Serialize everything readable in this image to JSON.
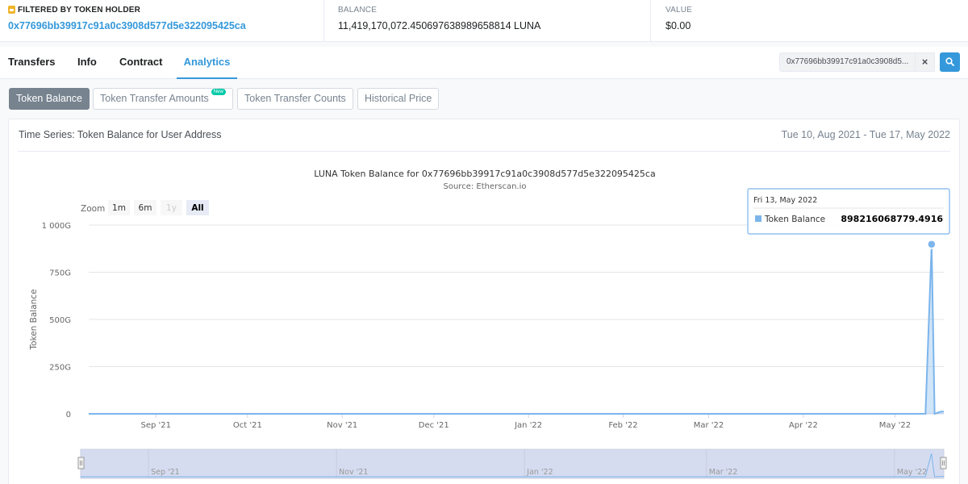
{
  "summary": {
    "filtered_label": "FILTERED BY TOKEN HOLDER",
    "holder_address": "0x77696bb39917c91a0c3908d577d5e322095425ca",
    "balance_label": "BALANCE",
    "balance_value": "11,419,170,072.450697638989658814 LUNA",
    "value_label": "VALUE",
    "value_amount": "$0.00"
  },
  "tabs": [
    {
      "label": "Transfers"
    },
    {
      "label": "Info"
    },
    {
      "label": "Contract"
    },
    {
      "label": "Analytics"
    }
  ],
  "active_tab": "Analytics",
  "search": {
    "value": "0x77696bb39917c91a0c3908d5...",
    "clear_icon": "×"
  },
  "chips": [
    {
      "label": "Token Balance"
    },
    {
      "label": "Token Transfer Amounts",
      "badge": "New"
    },
    {
      "label": "Token Transfer Counts"
    },
    {
      "label": "Historical Price"
    }
  ],
  "card": {
    "title": "Time Series: Token Balance for User Address",
    "date_range": "Tue 10, Aug 2021 - Tue 17, May 2022"
  },
  "zoom": {
    "label": "Zoom",
    "buttons": [
      "1m",
      "6m",
      "1y",
      "All"
    ],
    "selected": "All"
  },
  "tooltip": {
    "date": "Fri 13, May 2022",
    "series": "Token Balance",
    "value": "898216068779.4916"
  },
  "navigator": {
    "labels": [
      "Sep '21",
      "Nov '21",
      "Jan '22",
      "Mar '22",
      "May '22"
    ]
  },
  "colors": {
    "accent": "#3498db",
    "series": "#7cb5ec",
    "navigator_mask": "#d5dcf0"
  },
  "chart_data": {
    "type": "area",
    "title": "LUNA Token Balance for 0x77696bb39917c91a0c3908d577d5e322095425ca",
    "subtitle": "Source: Etherscan.io",
    "xlabel": "",
    "ylabel": "Token Balance",
    "x_ticks": [
      "Sep '21",
      "Oct '21",
      "Nov '21",
      "Dec '21",
      "Jan '22",
      "Feb '22",
      "Mar '22",
      "Apr '22",
      "May '22"
    ],
    "y_ticks": [
      "0",
      "250G",
      "500G",
      "750G",
      "1 000G"
    ],
    "ylim": [
      0,
      1000000000000
    ],
    "xlim": [
      "2021-08-10",
      "2022-05-17"
    ],
    "grid": true,
    "legend": "none",
    "series": [
      {
        "name": "Token Balance",
        "points": [
          {
            "x": "2021-08-10",
            "y": 0
          },
          {
            "x": "2022-05-11",
            "y": 0
          },
          {
            "x": "2022-05-13",
            "y": 898216068779.4916
          },
          {
            "x": "2022-05-14",
            "y": 0
          },
          {
            "x": "2022-05-16",
            "y": 11419170072
          },
          {
            "x": "2022-05-17",
            "y": 11419170072
          }
        ]
      }
    ]
  }
}
